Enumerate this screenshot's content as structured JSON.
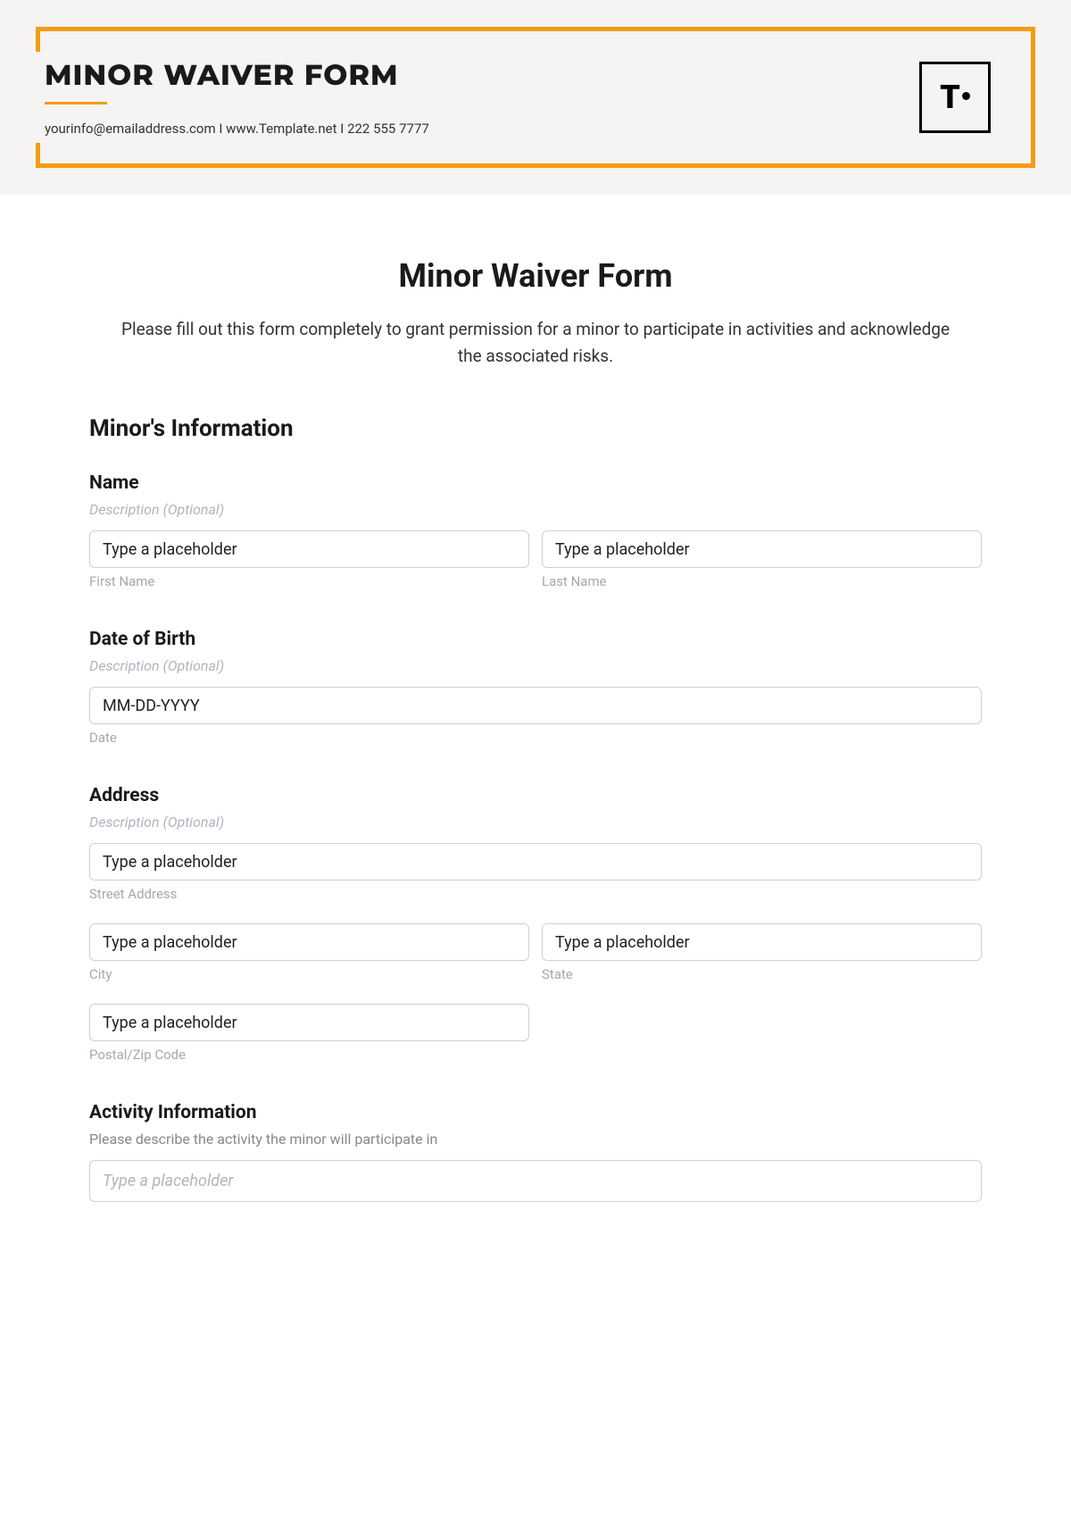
{
  "header": {
    "title": "MINOR WAIVER FORM",
    "email": "yourinfo@emailaddress.com",
    "separator": "  I  ",
    "website": "www.Template.net",
    "phone": "222 555 7777",
    "logo_text": "T"
  },
  "form": {
    "title": "Minor Waiver Form",
    "description": "Please fill out this form completely to grant permission for a minor to participate in activities and acknowledge the associated risks."
  },
  "sections": {
    "minors_info": {
      "heading": "Minor's Information",
      "name": {
        "label": "Name",
        "description": "Description (Optional)",
        "first_placeholder": "Type a placeholder",
        "last_placeholder": "Type a placeholder",
        "first_sublabel": "First Name",
        "last_sublabel": "Last Name"
      },
      "dob": {
        "label": "Date of Birth",
        "description": "Description (Optional)",
        "placeholder": "MM-DD-YYYY",
        "sublabel": "Date"
      },
      "address": {
        "label": "Address",
        "description": "Description (Optional)",
        "street_placeholder": "Type a placeholder",
        "street_sublabel": "Street Address",
        "city_placeholder": "Type a placeholder",
        "city_sublabel": "City",
        "state_placeholder": "Type a placeholder",
        "state_sublabel": "State",
        "postal_placeholder": "Type a placeholder",
        "postal_sublabel": "Postal/Zip Code"
      }
    },
    "activity_info": {
      "heading": "Activity Information",
      "description": "Please describe the activity the minor will participate in",
      "placeholder": "Type a placeholder"
    }
  }
}
